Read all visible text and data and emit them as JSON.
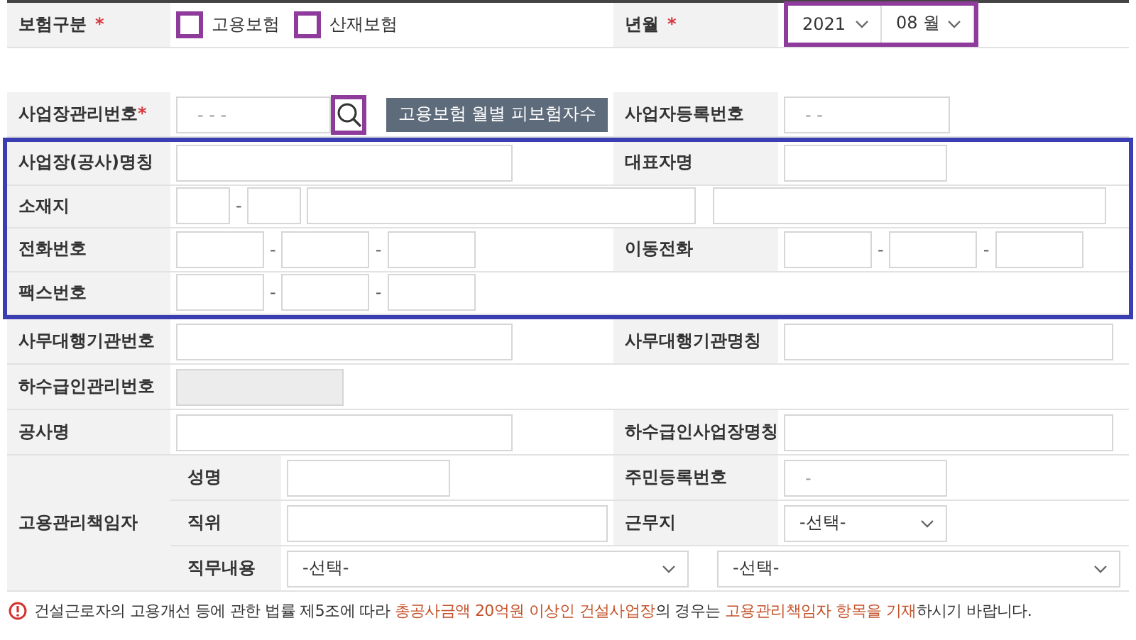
{
  "insurance_type": {
    "label": "보험구분",
    "required": "*",
    "options": [
      {
        "label": "고용보험",
        "checked": false
      },
      {
        "label": "산재보험",
        "checked": false
      }
    ]
  },
  "period": {
    "label": "년월",
    "required": "*",
    "year": "2021",
    "month": "08 월"
  },
  "workplace_number": {
    "label": "사업장관리번호",
    "required": "*",
    "placeholder": "- -   -",
    "button": "고용보험 월별 피보험자수"
  },
  "business_number": {
    "label": "사업자등록번호",
    "placeholder": "- -"
  },
  "site_name": {
    "label": "사업장(공사)명칭"
  },
  "representative": {
    "label": "대표자명"
  },
  "address": {
    "label": "소재지",
    "separator": "-"
  },
  "phone": {
    "label": "전화번호",
    "separators": [
      "-",
      "-"
    ]
  },
  "mobile": {
    "label": "이동전화",
    "separators": [
      "-",
      "-"
    ]
  },
  "fax": {
    "label": "팩스번호",
    "separators": [
      "-",
      "-"
    ]
  },
  "agency_number": {
    "label": "사무대행기관번호"
  },
  "agency_name": {
    "label": "사무대행기관명칭"
  },
  "subcontractor_number": {
    "label": "하수급인관리번호",
    "disabled": true
  },
  "project_name": {
    "label": "공사명"
  },
  "subcontractor_site": {
    "label": "하수급인사업장명칭"
  },
  "manager": {
    "label": "고용관리책임자",
    "name": {
      "label": "성명"
    },
    "resident_number": {
      "label": "주민등록번호",
      "placeholder": "-"
    },
    "position": {
      "label": "직위"
    },
    "workplace": {
      "label": "근무지",
      "value": "-선택-"
    },
    "duties": {
      "label": "직무내용",
      "values": [
        "-선택-",
        "-선택-"
      ]
    }
  },
  "notice": [
    {
      "text": "건설근로자의 고용개선 등에 관한 법률 제5조에 따라 ",
      "emphasis": false
    },
    {
      "text": "총공사금액 20억원 이상인 건설사업장",
      "emphasis": true
    },
    {
      "text": "의 경우는 ",
      "emphasis": false
    },
    {
      "text": "고용관리책임자 항목을 기재",
      "emphasis": true
    },
    {
      "text": "하시기 바랍니다.",
      "emphasis": false
    }
  ]
}
